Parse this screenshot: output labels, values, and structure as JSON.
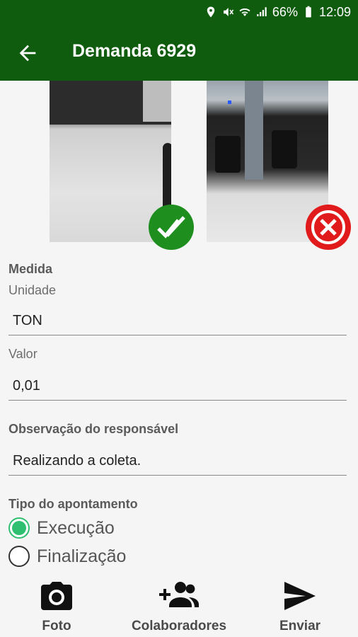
{
  "status_bar": {
    "battery": "66%",
    "time": "12:09"
  },
  "header": {
    "title": "Demanda 6929"
  },
  "form": {
    "medida_title": "Medida",
    "unidade_label": "Unidade",
    "unidade_value": "TON",
    "valor_label": "Valor",
    "valor_value": "0,01",
    "observacao_label": "Observação do responsável",
    "observacao_value": "Realizando a coleta.",
    "tipo_label": "Tipo do apontamento",
    "options": [
      {
        "label": "Execução",
        "selected": true
      },
      {
        "label": "Finalização",
        "selected": false
      }
    ]
  },
  "bottom_nav": [
    {
      "label": "Foto",
      "icon": "camera-icon"
    },
    {
      "label": "Colaboradores",
      "icon": "add-people-icon"
    },
    {
      "label": "Enviar",
      "icon": "send-icon"
    }
  ],
  "colors": {
    "primary": "#0f5c0f",
    "approve": "#1e8e1e",
    "reject": "#e11b1b",
    "radio_accent": "#2fbf71"
  }
}
